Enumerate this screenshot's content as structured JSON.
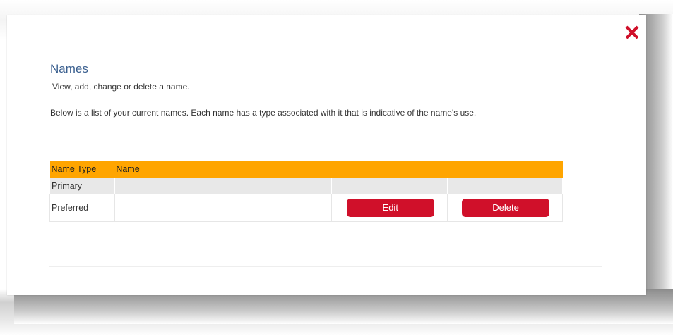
{
  "modal": {
    "title": "Names",
    "subtitle": "View, add, change or delete a name.",
    "description": "Below is a list of your current names. Each name has a type associated with it that is indicative of the name's use.",
    "close_icon": "close-x-icon"
  },
  "table": {
    "headers": {
      "type": "Name Type",
      "name": "Name"
    },
    "rows": [
      {
        "type": "Primary",
        "name": ""
      },
      {
        "type": "Preferred",
        "name": "",
        "edit_label": "Edit",
        "delete_label": "Delete"
      }
    ]
  },
  "colors": {
    "header_bg": "#ffa500",
    "button_bg": "#d0102a",
    "close_icon": "#d0102a",
    "title": "#3a5f8f"
  }
}
